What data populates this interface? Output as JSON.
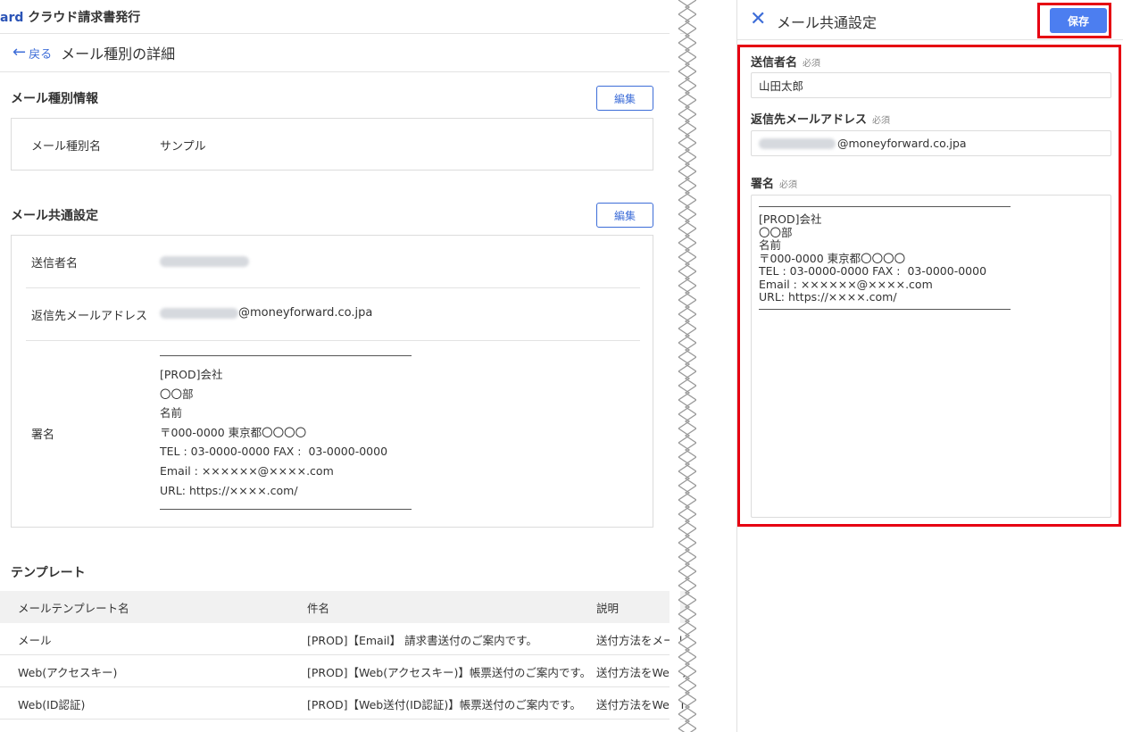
{
  "app": {
    "brand_tail": "ard",
    "title": "クラウド請求書発行"
  },
  "nav": {
    "back_label": "戻る",
    "page_title": "メール種別の詳細"
  },
  "mail_type": {
    "heading": "メール種別情報",
    "edit_label": "編集",
    "name_label": "メール種別名",
    "name_value": "サンプル"
  },
  "common": {
    "heading": "メール共通設定",
    "edit_label": "編集",
    "sender_label": "送信者名",
    "reply_label": "返信先メールアドレス",
    "reply_domain": "@moneyforward.co.jpa",
    "signature_label": "署名",
    "signature_lines": [
      "[PROD]会社",
      "〇〇部",
      "名前",
      "〒000-0000 東京都〇〇〇〇",
      "TEL : 03-0000-0000 FAX :  03-0000-0000",
      "Email : ××××××@××××.com",
      "URL: https://××××.com/"
    ]
  },
  "templates": {
    "heading": "テンプレート",
    "columns": [
      "メールテンプレート名",
      "件名",
      "説明"
    ],
    "rows": [
      [
        "メール",
        "[PROD]【Email】 請求書送付のご案内です。",
        "送付方法をメール"
      ],
      [
        "Web(アクセスキー)",
        "[PROD]【Web(アクセスキー)】帳票送付のご案内です。",
        "送付方法をWeb(ア"
      ],
      [
        "Web(ID認証)",
        "[PROD]【Web送付(ID認証)】帳票送付のご案内です。",
        "送付方法をWeb(I"
      ]
    ]
  },
  "drawer": {
    "title": "メール共通設定",
    "save_label": "保存",
    "sender_label": "送信者名",
    "sender_value": "山田太郎",
    "reply_label": "返信先メールアドレス",
    "reply_domain": "@moneyforward.co.jpa",
    "signature_label": "署名",
    "required_label": "必須",
    "highlight_color": "#e60012",
    "accent_color": "#4c7ef0"
  }
}
